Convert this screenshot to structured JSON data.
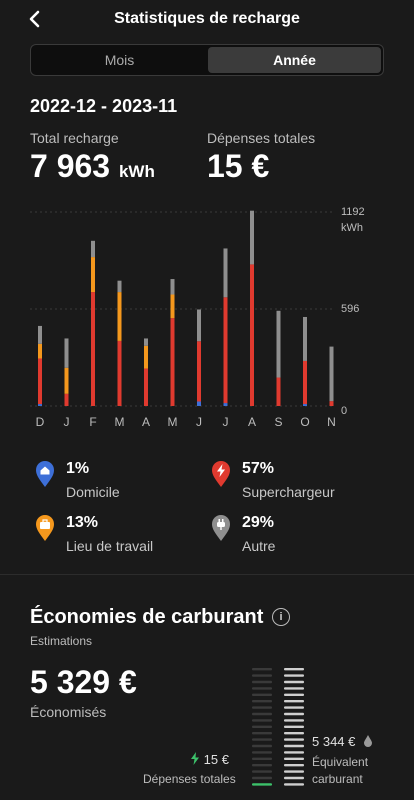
{
  "header": {
    "title": "Statistiques de recharge",
    "back_icon": "chevron-left-icon"
  },
  "segment": {
    "tabs": [
      "Mois",
      "Année"
    ],
    "selected": "Année"
  },
  "period": "2022-12 - 2023-11",
  "kpis": {
    "total_label": "Total recharge",
    "total_value": "7 963",
    "total_unit": "kWh",
    "cost_label": "Dépenses totales",
    "cost_value": "15 €"
  },
  "colors": {
    "domicile": "#3d6fd8",
    "travail": "#f5981d",
    "supercharge": "#e03a2f",
    "autre": "#8f8f8f"
  },
  "chart_data": {
    "type": "bar",
    "stacked": true,
    "categories": [
      "D",
      "J",
      "F",
      "M",
      "A",
      "M",
      "J",
      "J",
      "A",
      "S",
      "O",
      "N"
    ],
    "ytick_labels": [
      "1192",
      "kWh",
      "596",
      "0"
    ],
    "ylim": [
      0,
      1192
    ],
    "series": [
      {
        "key": "domicile",
        "values": [
          12,
          0,
          0,
          0,
          0,
          0,
          28,
          18,
          0,
          0,
          12,
          0
        ]
      },
      {
        "key": "supercharge",
        "values": [
          280,
          75,
          700,
          400,
          230,
          540,
          370,
          650,
          870,
          175,
          265,
          30
        ]
      },
      {
        "key": "travail",
        "values": [
          90,
          160,
          215,
          300,
          140,
          145,
          0,
          0,
          0,
          0,
          0,
          0
        ]
      },
      {
        "key": "autre",
        "values": [
          110,
          180,
          100,
          70,
          45,
          95,
          195,
          300,
          330,
          410,
          270,
          335
        ]
      }
    ]
  },
  "legend": [
    {
      "key": "domicile",
      "icon": "house-pin-icon",
      "pct": "1%",
      "label": "Domicile"
    },
    {
      "key": "supercharge",
      "icon": "lightning-pin-icon",
      "pct": "57%",
      "label": "Superchargeur"
    },
    {
      "key": "travail",
      "icon": "briefcase-pin-icon",
      "pct": "13%",
      "label": "Lieu de travail"
    },
    {
      "key": "autre",
      "icon": "plug-pin-icon",
      "pct": "29%",
      "label": "Autre"
    }
  ],
  "economies": {
    "title": "Économies de carburant",
    "subtitle": "Estimations",
    "value": "5 329 €",
    "value_label": "Économisés",
    "depenses_value": "15 €",
    "depenses_label": "Dépenses totales",
    "equivalent_value": "5 344 €",
    "equivalent_label": "Équivalent carburant"
  }
}
